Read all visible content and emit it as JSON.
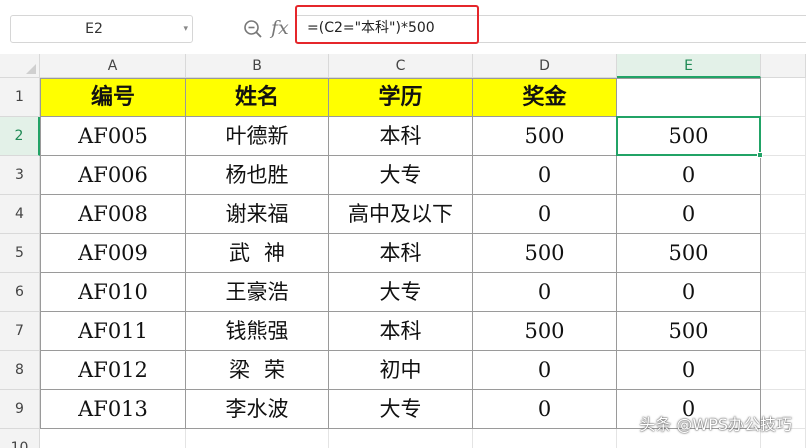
{
  "formula_bar": {
    "name_box": "E2",
    "name_box_arrow": "▾",
    "fx_label": "fx",
    "formula": "=(C2=\"本科\")*500"
  },
  "columns": [
    "A",
    "B",
    "C",
    "D",
    "E"
  ],
  "selected_column": "E",
  "rows": [
    "1",
    "2",
    "3",
    "4",
    "5",
    "6",
    "7",
    "8",
    "9",
    "10"
  ],
  "selected_row": "2",
  "table": {
    "headers": [
      "编号",
      "姓名",
      "学历",
      "奖金",
      ""
    ],
    "data": [
      [
        "AF005",
        "叶德新",
        "本科",
        "500",
        "500"
      ],
      [
        "AF006",
        "杨也胜",
        "大专",
        "0",
        "0"
      ],
      [
        "AF008",
        "谢来福",
        "高中及以下",
        "0",
        "0"
      ],
      [
        "AF009",
        "武神",
        "本科",
        "500",
        "500"
      ],
      [
        "AF010",
        "王豪浩",
        "大专",
        "0",
        "0"
      ],
      [
        "AF011",
        "钱熊强",
        "本科",
        "500",
        "500"
      ],
      [
        "AF012",
        "梁荣",
        "初中",
        "0",
        "0"
      ],
      [
        "AF013",
        "李水波",
        "大专",
        "0",
        "0"
      ]
    ]
  },
  "watermark": "头条 @WPS办公技巧",
  "colors": {
    "header_fill": "#ffff00",
    "selection": "#21a366",
    "formula_highlight": "#e5262b"
  }
}
